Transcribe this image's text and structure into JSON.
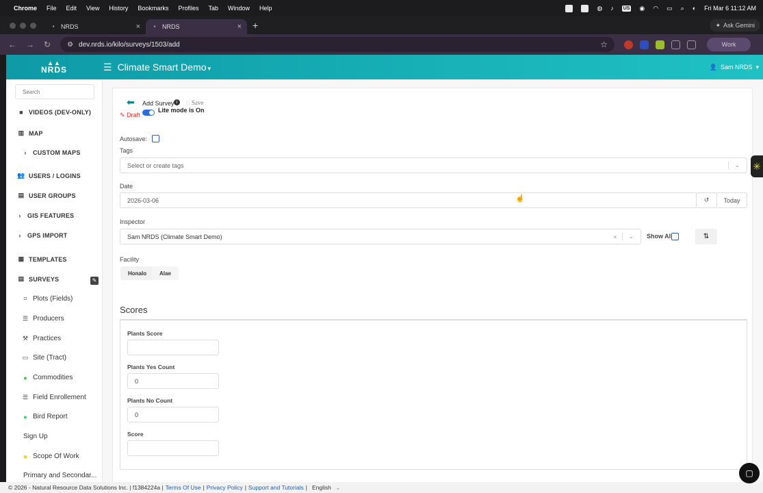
{
  "menubar": {
    "items": [
      "Chrome",
      "File",
      "Edit",
      "View",
      "History",
      "Bookmarks",
      "Profiles",
      "Tab",
      "Window",
      "Help"
    ],
    "keyboard": "US",
    "datetime": "Fri Mar 6  11:12 AM"
  },
  "browser": {
    "tabs": [
      {
        "title": "NRDS"
      },
      {
        "title": "NRDS"
      }
    ],
    "url": "dev.nrds.io/kilo/surveys/1503/add",
    "gemini_label": "Ask Gemini",
    "work_label": "Work"
  },
  "app": {
    "logo_text": "NRDS",
    "title": "Climate Smart Demo",
    "user": "Sam NRDS"
  },
  "sidebar": {
    "search_placeholder": "Search",
    "items": [
      {
        "label": "VIDEOS (DEV-ONLY)",
        "icon": "video-icon"
      },
      {
        "label": "MAP",
        "icon": "map-icon"
      },
      {
        "label": "CUSTOM MAPS",
        "icon": "chevron-right-icon"
      },
      {
        "label": "USERS / LOGINS",
        "icon": "users-icon"
      },
      {
        "label": "USER GROUPS",
        "icon": "group-icon"
      },
      {
        "label": "GIS FEATURES",
        "icon": "chevron-right-icon"
      },
      {
        "label": "GPS IMPORT",
        "icon": "chevron-right-icon"
      },
      {
        "label": "TEMPLATES",
        "icon": "templates-icon"
      },
      {
        "label": "SURVEYS",
        "icon": "surveys-icon"
      },
      {
        "label": "Plots (Fields)",
        "icon": "plots-icon"
      },
      {
        "label": "Producers",
        "icon": "list-icon"
      },
      {
        "label": "Practices",
        "icon": "practices-icon"
      },
      {
        "label": "Site (Tract)",
        "icon": "site-icon"
      },
      {
        "label": "Commodities",
        "icon": "dot-icon"
      },
      {
        "label": "Field Enrollement",
        "icon": "list-icon"
      },
      {
        "label": "Bird Report",
        "icon": "dot-icon"
      },
      {
        "label": "Sign Up",
        "icon": ""
      },
      {
        "label": "Scope Of Work",
        "icon": "dot-icon"
      },
      {
        "label": "Primary and Secondar...",
        "icon": ""
      }
    ]
  },
  "survey": {
    "title": "Add Survey",
    "save_label": "Save",
    "lite_mode_label": "Lite mode is On",
    "draft_label": "Draft",
    "autosave_label": "Autosave:",
    "tags_label": "Tags",
    "tags_placeholder": "Select or create tags",
    "date_label": "Date",
    "date_value": "2026-03-06",
    "today_label": "Today",
    "inspector_label": "Inspector",
    "inspector_value": "Sam NRDS (Climate Smart Demo)",
    "show_all_label": "Show All",
    "facility_label": "Facility",
    "facility_options": [
      "Honalo",
      "Alae"
    ],
    "scores_heading": "Scores",
    "scores": [
      {
        "label": "Plants Score",
        "value": ""
      },
      {
        "label": "Plants Yes Count",
        "value": "0"
      },
      {
        "label": "Plants No Count",
        "value": "0"
      },
      {
        "label": "Score",
        "value": ""
      }
    ]
  },
  "footer": {
    "copyright": "© 2026 - Natural Resource Data Solutions Inc. | f1384224a |",
    "links": [
      "Terms Of Use",
      "Privacy Policy",
      "Support and Tutorials"
    ],
    "language": "English"
  }
}
